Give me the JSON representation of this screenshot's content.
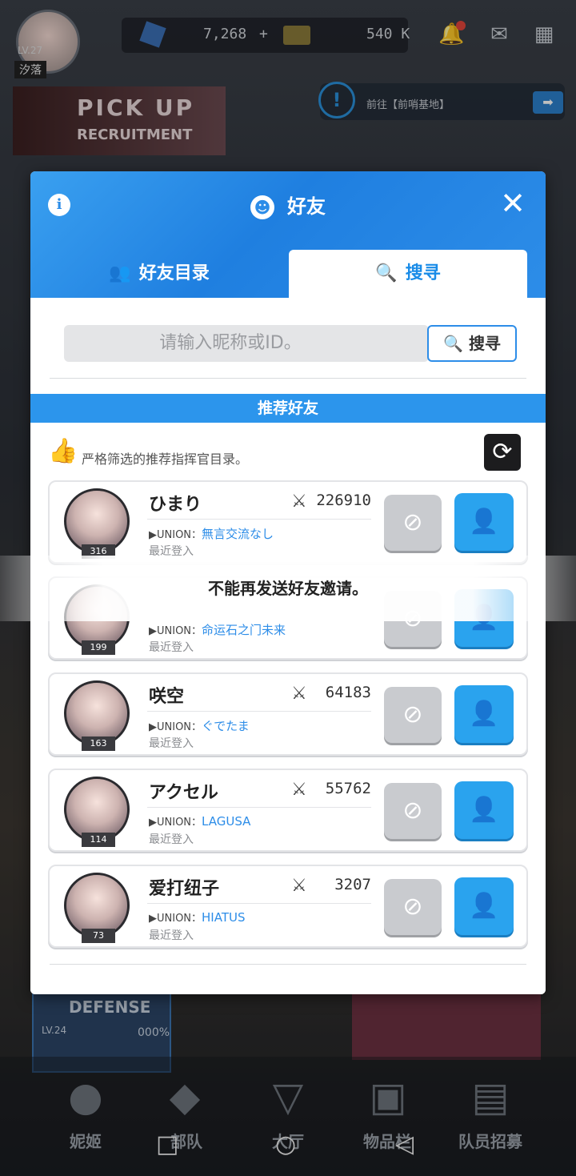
{
  "top_bar": {
    "level": "LV.27",
    "nickname": "汐落",
    "gems": "7,268",
    "gems_plus": "+",
    "credits": "540 K"
  },
  "banners": {
    "pickup_title": "PICK UP",
    "pickup_subtitle": "RECRUITMENT",
    "notice_text": "前往【前哨基地】",
    "bottom_card_level": "LV.24",
    "bottom_card_percent": "000%",
    "bottom_card_title": "DEFENSE"
  },
  "bottom_nav": [
    {
      "label": "妮姬",
      "icon": "nikke-icon"
    },
    {
      "label": "部队",
      "icon": "squad-icon"
    },
    {
      "label": "大厅",
      "icon": "lobby-icon"
    },
    {
      "label": "物品栏",
      "icon": "inventory-icon"
    },
    {
      "label": "队员招募",
      "icon": "recruit-icon"
    }
  ],
  "modal": {
    "title": "好友",
    "tabs": {
      "list": "好友目录",
      "search": "搜寻"
    },
    "search": {
      "placeholder": "请输入昵称或ID。",
      "button": "搜寻"
    },
    "recommend_header": "推荐好友",
    "recommend_desc": "严格筛选的推荐指挥官目录。",
    "union_label": "▶UNION：",
    "last_login_label": "最近登入",
    "friends": [
      {
        "name": "ひまり",
        "level": "316",
        "power": "226910",
        "union": "無言交流なし"
      },
      {
        "name": "",
        "level": "199",
        "power": "",
        "union": "命运石之门未来"
      },
      {
        "name": "咲空",
        "level": "163",
        "power": "64183",
        "union": "ぐでたま"
      },
      {
        "name": "アクセル",
        "level": "114",
        "power": "55762",
        "union": "LAGUSA"
      },
      {
        "name": "爱打纽子",
        "level": "73",
        "power": "3207",
        "union": "HIATUS"
      }
    ]
  },
  "toast": "不能再发送好友邀请。",
  "colors": {
    "accent": "#2c95ec",
    "add_button": "#2aa3ee",
    "block_button": "#c9cbcf"
  }
}
